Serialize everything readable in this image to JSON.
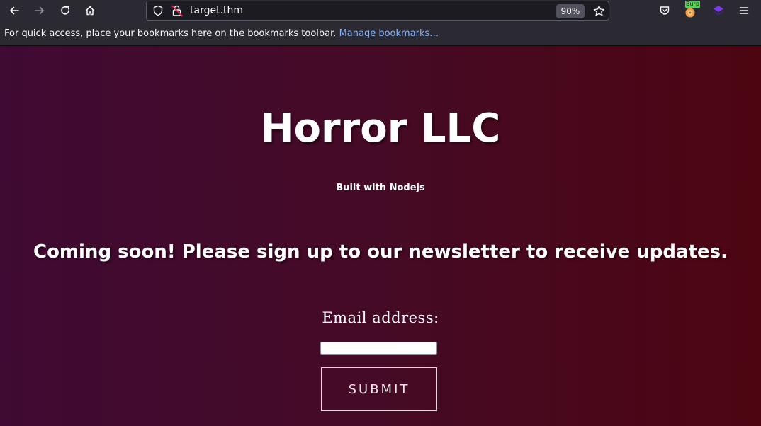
{
  "browser": {
    "url": "target.thm",
    "zoom": "90%",
    "bookmarks_bar": {
      "message": "For quick access, place your bookmarks here on the bookmarks toolbar.",
      "link_label": "Manage bookmarks…"
    },
    "extensions": {
      "burp_badge": "Burp"
    },
    "icons": {
      "back": "arrow-left-icon",
      "forward": "arrow-right-icon",
      "reload": "reload-icon",
      "home": "home-icon",
      "tracking_protection": "shield-icon",
      "connection": "insecure-lock-icon",
      "bookmark": "star-icon",
      "pocket": "pocket-icon",
      "burp": "burp-extension-icon",
      "wappalyzer": "wappalyzer-extension-icon",
      "menu": "hamburger-menu-icon"
    },
    "colors": {
      "toolbar_bg": "#2b2a33",
      "urlbar_bg": "#1c1b22",
      "link": "#8ab4f8",
      "burp_badge_bg": "#57d25a",
      "wappalyzer": "#5b21b6"
    }
  },
  "page": {
    "title": "Horror LLC",
    "subtitle": "Built with Nodejs",
    "announcement": "Coming soon! Please sign up to our newsletter to receive updates.",
    "form": {
      "email_label": "Email address:",
      "email_value": "",
      "submit_label": "SUBMIT"
    },
    "colors": {
      "gradient_left": "#3f0a33",
      "gradient_right": "#4d0512",
      "text": "#ffffff"
    }
  }
}
